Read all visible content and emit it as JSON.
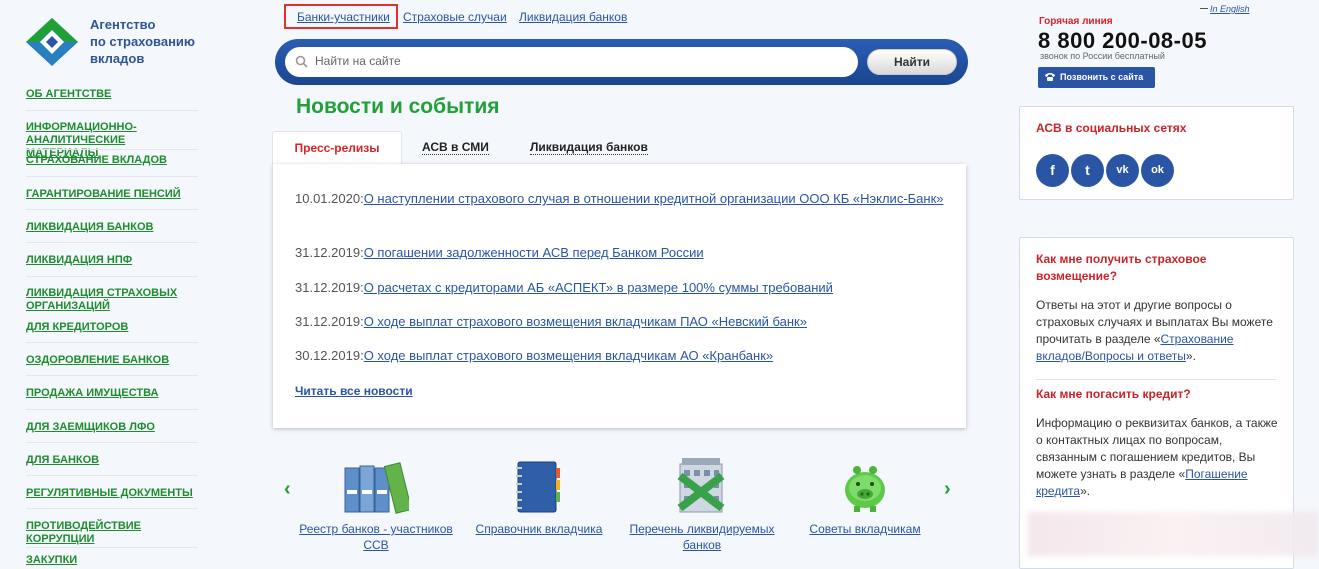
{
  "logo": {
    "lines": [
      "Агентство",
      "по страхованию",
      "вкладов"
    ],
    "icon": "asv-logo"
  },
  "leftnav": [
    "ОБ АГЕНТСТВЕ",
    "ИНФОРМАЦИОННО-АНАЛИТИЧЕСКИЕ МАТЕРИАЛЫ",
    "СТРАХОВАНИЕ ВКЛАДОВ",
    "ГАРАНТИРОВАНИЕ ПЕНСИЙ",
    "ЛИКВИДАЦИЯ БАНКОВ",
    "ЛИКВИДАЦИЯ НПФ",
    "ЛИКВИДАЦИЯ СТРАХОВЫХ ОРГАНИЗАЦИЙ",
    "ДЛЯ КРЕДИТОРОВ",
    "ОЗДОРОВЛЕНИЕ БАНКОВ",
    "ПРОДАЖА ИМУЩЕСТВА",
    "ДЛЯ ЗАЕМЩИКОВ ЛФО",
    "ДЛЯ БАНКОВ",
    "РЕГУЛЯТИВНЫЕ ДОКУМЕНТЫ",
    "ПРОТИВОДЕЙСТВИЕ КОРРУПЦИИ",
    "ЗАКУПКИ"
  ],
  "toplinks": [
    "Банки-участники",
    "Страховые случаи",
    "Ликвидация банков"
  ],
  "search": {
    "placeholder": "Найти на сайте",
    "button": "Найти"
  },
  "news": {
    "title": "Новости и события",
    "tabs": [
      "Пресс-релизы",
      "АСВ в СМИ",
      "Ликвидация банков"
    ],
    "items": [
      {
        "date": "10.01.2020:",
        "text": "О наступлении страхового случая в отношении кредитной организации ООО КБ «Нэклис-Банк»"
      },
      {
        "date": "31.12.2019:",
        "text": "О погашении задолженности АСВ перед Банком России"
      },
      {
        "date": "31.12.2019:",
        "text": "О расчетах с кредиторами АБ «АСПЕКТ» в размере 100% суммы требований"
      },
      {
        "date": "31.12.2019:",
        "text": "О ходе выплат страхового возмещения вкладчикам ПАО «Невский банк»"
      },
      {
        "date": "30.12.2019:",
        "text": "О ходе выплат страхового возмещения вкладчикам АО «Кранбанк»"
      }
    ],
    "read_all": "Читать все новости"
  },
  "carousel": [
    {
      "label": "Реестр банков - участников ССВ",
      "icon": "folders-icon"
    },
    {
      "label": "Справочник вкладчика",
      "icon": "notebook-icon"
    },
    {
      "label": "Перечень ликвидируемых банков",
      "icon": "closed-bank-icon"
    },
    {
      "label": "Советы вкладчикам",
      "icon": "piggy-bank-icon"
    }
  ],
  "hotline": {
    "english": "In English",
    "label": "Горячая линия",
    "number": "8 800 200-08-05",
    "note": "звонок по России бесплатный",
    "call_button": "Позвонить с сайта"
  },
  "social": {
    "title": "АСВ в социальных сетях",
    "icons": [
      {
        "name": "facebook-icon",
        "glyph": "f"
      },
      {
        "name": "twitter-icon",
        "glyph": "t"
      },
      {
        "name": "vk-icon",
        "glyph": "vk"
      },
      {
        "name": "odnoklassniki-icon",
        "glyph": "ok"
      }
    ]
  },
  "faq": [
    {
      "q": "Как мне получить страховое возмещение?",
      "a_before": "Ответы на этот и другие вопросы о страховых случаях и выплатах Вы можете прочитать в разделе «",
      "link": "Страхование вкладов/Вопросы и ответы",
      "a_after": "»."
    },
    {
      "q": "Как мне погасить кредит?",
      "a_before": "Информацию о реквизитах банков, а также о контактных лицах по вопросам, связанным с погашением кредитов, Вы можете узнать в разделе «",
      "link": "Погашение кредита",
      "a_after": "»."
    }
  ],
  "colors": {
    "green": "#21a038",
    "blue": "#2a55a5",
    "red": "#d8232a"
  }
}
